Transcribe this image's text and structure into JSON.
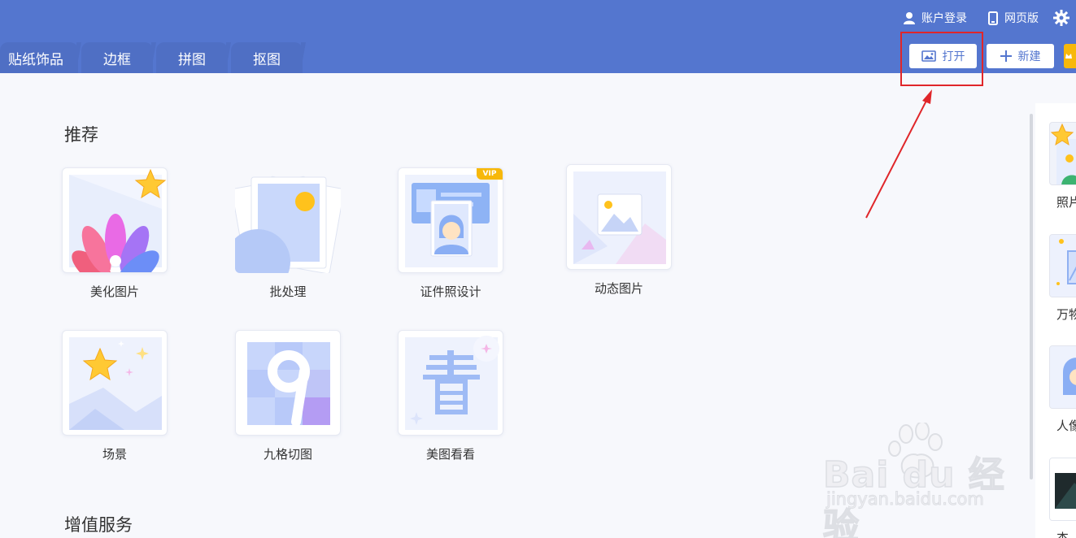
{
  "header": {
    "links": {
      "account": "账户登录",
      "web": "网页版"
    },
    "tabs": [
      "贴纸饰品",
      "边框",
      "拼图",
      "抠图"
    ],
    "buttons": {
      "open": "打开",
      "new": "新建"
    }
  },
  "main": {
    "recommend_title": "推荐",
    "value_title": "增值服务",
    "cards": [
      {
        "label": "美化图片"
      },
      {
        "label": "批处理"
      },
      {
        "label": "证件照设计",
        "badge": "VIP"
      },
      {
        "label": "动态图片"
      },
      {
        "label": "场景"
      },
      {
        "label": "九格切图"
      },
      {
        "label": "美图看看"
      }
    ]
  },
  "right_panel": {
    "items": [
      "照片",
      "万物",
      "人像",
      "杰"
    ]
  },
  "watermark": {
    "brand": "Bai du 经验",
    "url": "jingyan.baidu.com"
  },
  "colors": {
    "header": "#5476cf",
    "accent": "#5476cf",
    "highlight": "#e0262a",
    "yellow": "#f7b80a"
  }
}
